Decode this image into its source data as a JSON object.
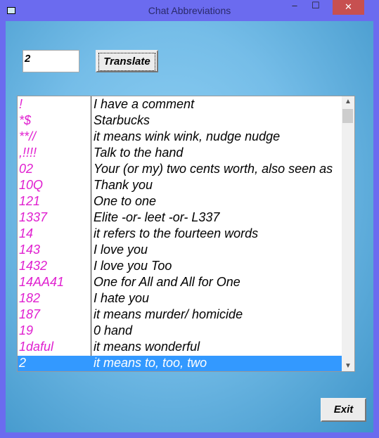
{
  "window": {
    "title": "Chat Abbreviations",
    "minimize": "–",
    "maximize": "☐",
    "close": "✕"
  },
  "search": {
    "value": "2"
  },
  "buttons": {
    "translate": "Translate",
    "exit": "Exit"
  },
  "list": {
    "selected_index": 16,
    "scroll_position": 0.05,
    "items": [
      {
        "abbr": "!",
        "meaning": "I have a comment"
      },
      {
        "abbr": "*$",
        "meaning": "Starbucks"
      },
      {
        "abbr": "**//",
        "meaning": "it means wink wink, nudge nudge"
      },
      {
        "abbr": ",!!!!",
        "meaning": "Talk to the hand"
      },
      {
        "abbr": "02",
        "meaning": "Your (or my) two cents worth, also seen as"
      },
      {
        "abbr": "10Q",
        "meaning": "Thank you"
      },
      {
        "abbr": "121",
        "meaning": "One to one"
      },
      {
        "abbr": "1337",
        "meaning": "Elite -or- leet -or- L337"
      },
      {
        "abbr": "14",
        "meaning": "it refers to the fourteen words"
      },
      {
        "abbr": "143",
        "meaning": "I love you"
      },
      {
        "abbr": "1432",
        "meaning": "I love you Too"
      },
      {
        "abbr": "14AA41",
        "meaning": "One for All and All for One"
      },
      {
        "abbr": "182",
        "meaning": "I hate you"
      },
      {
        "abbr": "187",
        "meaning": "it means murder/ homicide"
      },
      {
        "abbr": "19",
        "meaning": "0 hand"
      },
      {
        "abbr": "1daful",
        "meaning": "it means wonderful"
      },
      {
        "abbr": "2",
        "meaning": "it means to, too, two"
      }
    ]
  },
  "colors": {
    "titlebar": "#6b6bef",
    "abbr": "#e020d0",
    "selection": "#3399ff"
  }
}
